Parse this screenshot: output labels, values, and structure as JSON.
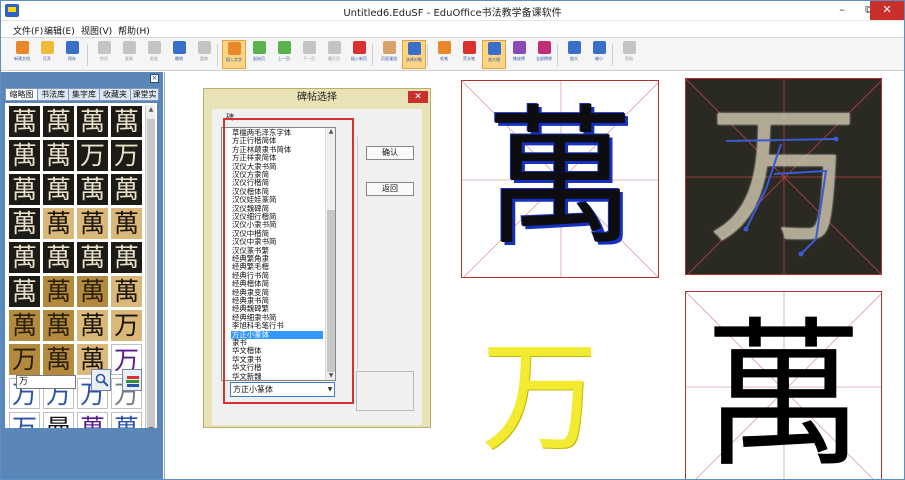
{
  "window": {
    "title": "Untitled6.EduSF - EduOffice书法教学备课软件",
    "min": "–",
    "max": "⧉",
    "close": "✕"
  },
  "menu": [
    "文件(F)",
    "编辑(E)",
    "视图(V)",
    "帮助(H)"
  ],
  "toolbar": [
    {
      "label": "新建文档",
      "icon": "new-doc-icon",
      "color": "#e8882a"
    },
    {
      "label": "打开",
      "icon": "open-folder-icon",
      "color": "#f0b93a"
    },
    {
      "label": "保存",
      "icon": "save-icon",
      "color": "#3a6fc9"
    },
    {
      "label": "剪切",
      "icon": "cut-icon",
      "color": "#8a8a8a"
    },
    {
      "label": "复制",
      "icon": "copy-icon",
      "color": "#8a8a8a"
    },
    {
      "label": "粘贴",
      "icon": "paste-icon",
      "color": "#8a8a8a"
    },
    {
      "label": "撤销",
      "icon": "undo-icon",
      "color": "#3a6fc9"
    },
    {
      "label": "重做",
      "icon": "redo-icon",
      "color": "#8a8a8a"
    },
    {
      "label": "插入文字",
      "icon": "insert-text-icon",
      "color": "#e8882a"
    },
    {
      "label": "起始页",
      "icon": "start-page-icon",
      "color": "#59b34a"
    },
    {
      "label": "上一页",
      "icon": "prev-page-icon",
      "color": "#59b34a"
    },
    {
      "label": "下一页",
      "icon": "next-page-icon",
      "color": "#8a8a8a"
    },
    {
      "label": "最后页",
      "icon": "last-page-icon",
      "color": "#8a8a8a"
    },
    {
      "label": "插入新页",
      "icon": "insert-page-icon",
      "color": "#d93030"
    },
    {
      "label": "页面漫游",
      "icon": "hand-icon",
      "color": "#d9a26a"
    },
    {
      "label": "选择对象",
      "icon": "cursor-icon",
      "color": "#3a6fc9"
    },
    {
      "label": "毛笔",
      "icon": "brush-icon",
      "color": "#e8882a"
    },
    {
      "label": "荧光笔",
      "icon": "highlighter-icon",
      "color": "#d93030"
    },
    {
      "label": "放大镜",
      "icon": "magnifier-icon",
      "color": "#3a6fc9"
    },
    {
      "label": "橡皮擦",
      "icon": "eraser-icon",
      "color": "#8a4ab3"
    },
    {
      "label": "全部擦除",
      "icon": "clear-all-icon",
      "color": "#c0307a"
    },
    {
      "label": "放大",
      "icon": "zoom-in-icon",
      "color": "#3a6fc9"
    },
    {
      "label": "缩小",
      "icon": "zoom-out-icon",
      "color": "#3a6fc9"
    },
    {
      "label": "帮助",
      "icon": "help-icon",
      "color": "#8a8a8a"
    }
  ],
  "left_panel": {
    "tabs": [
      "缩略图",
      "书法库",
      "集字库",
      "收藏夹",
      "课堂实"
    ],
    "active_tab": 0,
    "thumbnails": [
      {
        "char": "萬",
        "style": "dark"
      },
      {
        "char": "萬",
        "style": "dark"
      },
      {
        "char": "萬",
        "style": "dark"
      },
      {
        "char": "萬",
        "style": "dark"
      },
      {
        "char": "萬",
        "style": "dark"
      },
      {
        "char": "萬",
        "style": "dark"
      },
      {
        "char": "万",
        "style": "dark"
      },
      {
        "char": "万",
        "style": "dark"
      },
      {
        "char": "萬",
        "style": "dark"
      },
      {
        "char": "萬",
        "style": "dark"
      },
      {
        "char": "萬",
        "style": "dark"
      },
      {
        "char": "萬",
        "style": "dark"
      },
      {
        "char": "萬",
        "style": "dark"
      },
      {
        "char": "萬",
        "style": "tan"
      },
      {
        "char": "萬",
        "style": "tan"
      },
      {
        "char": "萬",
        "style": "tan"
      },
      {
        "char": "萬",
        "style": "dark"
      },
      {
        "char": "萬",
        "style": "dark"
      },
      {
        "char": "萬",
        "style": "dark"
      },
      {
        "char": "萬",
        "style": "dark"
      },
      {
        "char": "萬",
        "style": "dark"
      },
      {
        "char": "萬",
        "style": "gold"
      },
      {
        "char": "萬",
        "style": "gold"
      },
      {
        "char": "萬",
        "style": "tan"
      },
      {
        "char": "萬",
        "style": "gold"
      },
      {
        "char": "萬",
        "style": "gold"
      },
      {
        "char": "萬",
        "style": "tan"
      },
      {
        "char": "万",
        "style": "tan"
      },
      {
        "char": "万",
        "style": "gold"
      },
      {
        "char": "萬",
        "style": "gold"
      },
      {
        "char": "萬",
        "style": "tan"
      },
      {
        "char": "万",
        "style": "pur"
      },
      {
        "char": "万",
        "style": "light"
      },
      {
        "char": "万",
        "style": "light"
      },
      {
        "char": "万",
        "style": "light"
      },
      {
        "char": "万",
        "style": "light2"
      },
      {
        "char": "万",
        "style": "light"
      },
      {
        "char": "曼",
        "style": "bk"
      },
      {
        "char": "萬",
        "style": "pur"
      },
      {
        "char": "萬",
        "style": "light"
      }
    ],
    "search_value": "万"
  },
  "dialog": {
    "title": "碑帖选择",
    "close": "✕",
    "hint": "碑",
    "ok": "确认",
    "back": "返回",
    "items": [
      "草檀两毛泽东字体",
      "方正行楷简体",
      "方正林颠隶书简体",
      "方正祥隶简体",
      "汉仪大隶书简",
      "汉仪方隶简",
      "汉仪行楷简",
      "汉仪楷体简",
      "汉仪娃娃篆简",
      "汉仪魏碑简",
      "汉仪细行楷简",
      "汉仪小隶书简",
      "汉仪中楷简",
      "汉仪中隶书简",
      "汉仪篆书繁",
      "经典繁角隶",
      "经典繁毛楷",
      "经典行书简",
      "经典楷体简",
      "经典隶变简",
      "经典隶书简",
      "经典魏碑繁",
      "经典细隶书简",
      "李旭科毛笔行书",
      "方正小篆体",
      "隶书",
      "华文楷体",
      "华文隶书",
      "华文行楷",
      "华文新魏"
    ],
    "selected_index": 24,
    "combo_value": "方正小篆体"
  },
  "canvas": {
    "char1": "萬",
    "char2": "万",
    "char3": "万",
    "char4": "萬"
  }
}
